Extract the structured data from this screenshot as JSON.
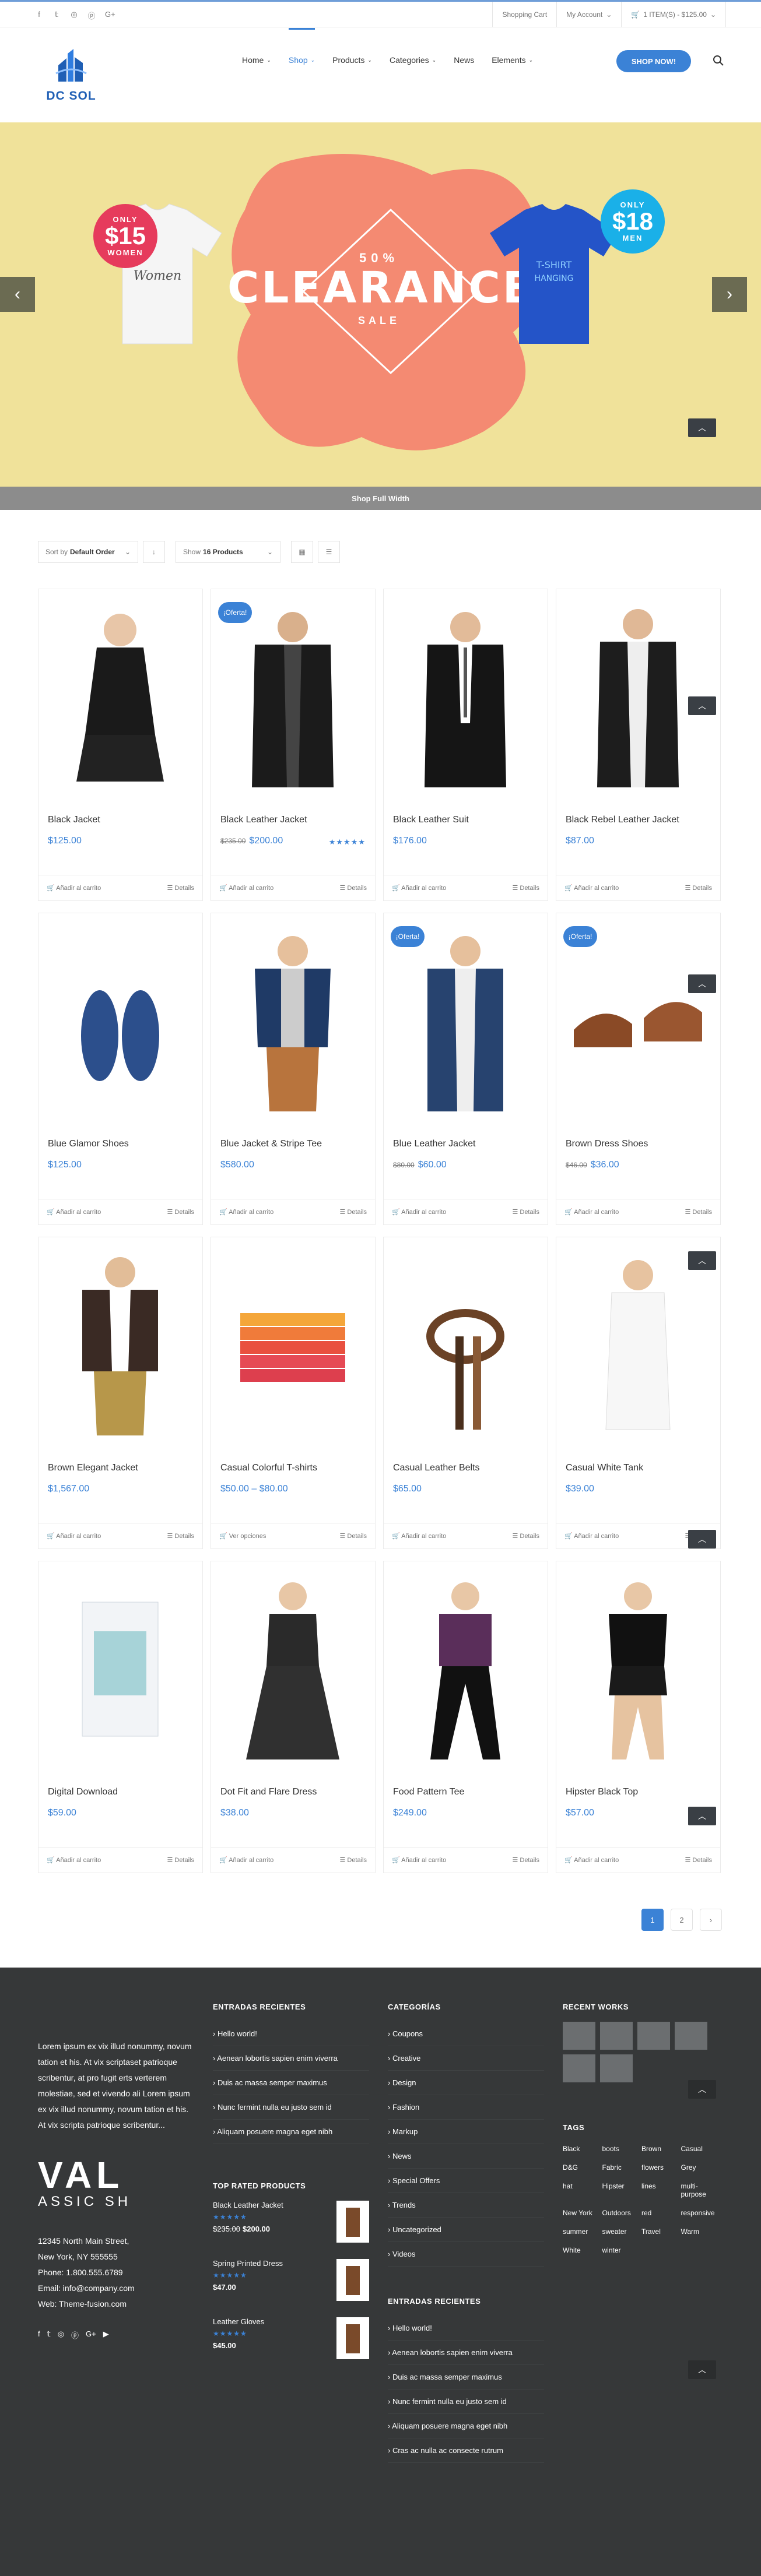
{
  "topbar": {
    "social_icons": [
      "facebook-icon",
      "twitter-icon",
      "instagram-icon",
      "pinterest-icon",
      "google-plus-icon"
    ],
    "links": [
      "Shopping Cart",
      "My Account",
      "1 ITEM(S) - $125.00"
    ]
  },
  "header": {
    "logo_text": "DC SOL",
    "nav": [
      {
        "label": "Home",
        "has_caret": true
      },
      {
        "label": "Shop",
        "has_caret": true,
        "active": true
      },
      {
        "label": "Products",
        "has_caret": true
      },
      {
        "label": "Categories",
        "has_caret": true
      },
      {
        "label": "News",
        "has_caret": false
      },
      {
        "label": "Elements",
        "has_caret": true
      }
    ],
    "cta": "SHOP NOW!"
  },
  "hero": {
    "percent": "50%",
    "headline": "CLEARANCE",
    "sale": "SALE",
    "badge_women": {
      "only": "ONLY",
      "price": "$15",
      "label": "WOMEN"
    },
    "badge_men": {
      "only": "ONLY",
      "price": "$18",
      "label": "MEN"
    },
    "footer_link": "Shop Full Width"
  },
  "toolbar": {
    "sort_prefix": "Sort by",
    "sort_value": "Default Order",
    "show_prefix": "Show",
    "show_value": "16 Products"
  },
  "product_actions": {
    "add_to_cart": "Añadir al carrito",
    "details": "Details",
    "options": "Ver opciones"
  },
  "products": [
    {
      "name": "Black Jacket",
      "price": "$125.00",
      "old": "",
      "sale": false,
      "stars": false
    },
    {
      "name": "Black Leather Jacket",
      "price": "$200.00",
      "old": "$235.00",
      "sale": true,
      "stars": true
    },
    {
      "name": "Black Leather Suit",
      "price": "$176.00",
      "old": "",
      "sale": false,
      "stars": false
    },
    {
      "name": "Black Rebel Leather Jacket",
      "price": "$87.00",
      "old": "",
      "sale": false,
      "stars": false
    },
    {
      "name": "Blue Glamor Shoes",
      "price": "$125.00",
      "old": "",
      "sale": false,
      "stars": false
    },
    {
      "name": "Blue Jacket & Stripe Tee",
      "price": "$580.00",
      "old": "",
      "sale": false,
      "stars": false
    },
    {
      "name": "Blue Leather Jacket",
      "price": "$60.00",
      "old": "$80.00",
      "sale": true,
      "stars": false
    },
    {
      "name": "Brown Dress Shoes",
      "price": "$36.00",
      "old": "$46.00",
      "sale": true,
      "stars": false
    },
    {
      "name": "Brown Elegant Jacket",
      "price": "$1,567.00",
      "old": "",
      "sale": false,
      "stars": false
    },
    {
      "name": "Casual Colorful T-shirts",
      "price": "$50.00 – $80.00",
      "old": "",
      "sale": false,
      "stars": false,
      "options": true
    },
    {
      "name": "Casual Leather Belts",
      "price": "$65.00",
      "old": "",
      "sale": false,
      "stars": false
    },
    {
      "name": "Casual White Tank",
      "price": "$39.00",
      "old": "",
      "sale": false,
      "stars": false
    },
    {
      "name": "Digital Download",
      "price": "$59.00",
      "old": "",
      "sale": false,
      "stars": false
    },
    {
      "name": "Dot Fit and Flare Dress",
      "price": "$38.00",
      "old": "",
      "sale": false,
      "stars": false
    },
    {
      "name": "Food Pattern Tee",
      "price": "$249.00",
      "old": "",
      "sale": false,
      "stars": false
    },
    {
      "name": "Hipster Black Top",
      "price": "$57.00",
      "old": "",
      "sale": false,
      "stars": false
    }
  ],
  "sale_badge": "¡Oferta!",
  "pagination": [
    "1",
    "2",
    "›"
  ],
  "footer": {
    "about": "Lorem ipsum ex vix illud nonummy, novum tation et his. At vix scriptaset patrioque scribentur, at pro fugit erts verterem molestiae, sed et vivendo ali Lorem ipsum ex vix illud nonummy, novum tation et his. At vix scripta patrioque scribentur...",
    "brand_big": "VAL",
    "brand_sub": "ASSIC SH",
    "address": [
      "12345 North Main Street,",
      "New York, NY 555555",
      "Phone: 1.800.555.6789",
      "Email: info@company.com",
      "Web: Theme-fusion.com"
    ],
    "recent_title": "ENTRADAS RECIENTES",
    "recent": [
      "Hello world!",
      "Aenean lobortis sapien enim viverra",
      "Duis ac massa semper maximus",
      "Nunc fermint nulla eu justo sem id",
      "Aliquam posuere magna eget nibh"
    ],
    "top_rated_title": "TOP RATED PRODUCTS",
    "top_rated": [
      {
        "name": "Black Leather Jacket",
        "old": "$235.00",
        "price": "$200.00"
      },
      {
        "name": "Spring Printed Dress",
        "old": "",
        "price": "$47.00"
      },
      {
        "name": "Leather Gloves",
        "old": "",
        "price": "$45.00"
      }
    ],
    "categories_title": "CATEGORÍAS",
    "categories": [
      "Coupons",
      "Creative",
      "Design",
      "Fashion",
      "Markup",
      "News",
      "Special Offers",
      "Trends",
      "Uncategorized",
      "Videos"
    ],
    "recent2_title": "ENTRADAS RECIENTES",
    "recent2": [
      "Hello world!",
      "Aenean lobortis sapien enim viverra",
      "Duis ac massa semper maximus",
      "Nunc fermint nulla eu justo sem id",
      "Aliquam posuere magna eget nibh",
      "Cras ac nulla ac consecte rutrum"
    ],
    "works_title": "RECENT WORKS",
    "tags_title": "TAGS",
    "tags": [
      "Black",
      "boots",
      "Brown",
      "Casual",
      "D&G",
      "Fabric",
      "flowers",
      "Grey",
      "hat",
      "Hipster",
      "lines",
      "multi-purpose",
      "New York",
      "Outdoors",
      "red",
      "responsive",
      "summer",
      "sweater",
      "Travel",
      "Warm",
      "White",
      "winter"
    ]
  },
  "colors": {
    "accent": "#3b82d6",
    "footer_bg": "#363839",
    "hero_bg": "#f0e29a",
    "splash": "#f48a72"
  }
}
